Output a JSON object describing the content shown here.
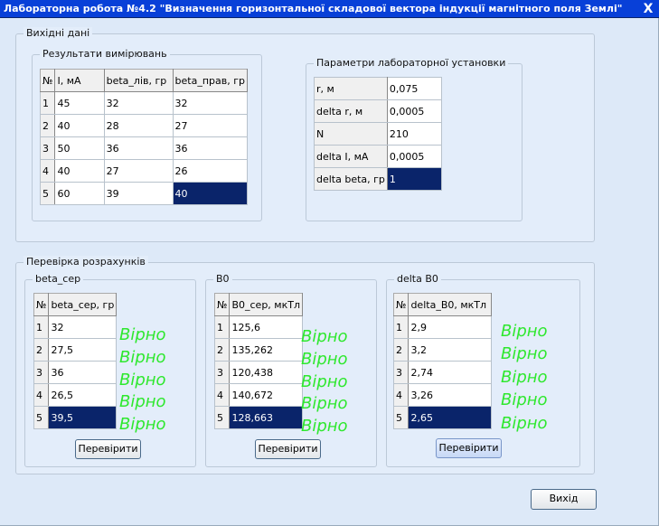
{
  "window": {
    "title": "Лабораторна робота №4.2 \"Визначення горизонтальної складової вектора індукції магнітного поля Землі\"",
    "close_glyph": "X"
  },
  "input_group": {
    "label": "Вихідні дані"
  },
  "measurements": {
    "label": "Результати вимірювань",
    "headers": [
      "№",
      "I, мА",
      "beta_лів, гр",
      "beta_прав, гр"
    ],
    "rows": [
      [
        "1",
        "45",
        "32",
        "32"
      ],
      [
        "2",
        "40",
        "28",
        "27"
      ],
      [
        "3",
        "50",
        "36",
        "36"
      ],
      [
        "4",
        "40",
        "27",
        "26"
      ],
      [
        "5",
        "60",
        "39",
        "40"
      ]
    ]
  },
  "parameters": {
    "label": "Параметри лабораторної установки",
    "rows": [
      [
        "r, м",
        "0,075"
      ],
      [
        "delta r, м",
        "0,0005"
      ],
      [
        "N",
        "210"
      ],
      [
        "delta I, мА",
        "0,0005"
      ],
      [
        "delta beta, гр",
        "1"
      ]
    ]
  },
  "check_group": {
    "label": "Перевірка розрахунків"
  },
  "beta_avg": {
    "label": "beta_сер",
    "headers": [
      "№",
      "beta_сер, гр"
    ],
    "rows": [
      [
        "1",
        "32"
      ],
      [
        "2",
        "27,5"
      ],
      [
        "3",
        "36"
      ],
      [
        "4",
        "26,5"
      ],
      [
        "5",
        "39,5"
      ]
    ],
    "button": "Перевірити"
  },
  "b0": {
    "label": "B0",
    "headers": [
      "№",
      "B0_сер, мкТл"
    ],
    "rows": [
      [
        "1",
        "125,6"
      ],
      [
        "2",
        "135,262"
      ],
      [
        "3",
        "120,438"
      ],
      [
        "4",
        "140,672"
      ],
      [
        "5",
        "128,663"
      ]
    ],
    "button": "Перевірити"
  },
  "delta_b0": {
    "label": "delta B0",
    "headers": [
      "№",
      "delta_B0, мкТл"
    ],
    "rows": [
      [
        "1",
        "2,9"
      ],
      [
        "2",
        "3,2"
      ],
      [
        "3",
        "2,74"
      ],
      [
        "4",
        "3,26"
      ],
      [
        "5",
        "2,65"
      ]
    ],
    "button": "Перевірити"
  },
  "verdict": "Вірно",
  "exit_button": "Вихід",
  "colors": {
    "titlebar": "#0840d8",
    "selection": "#0a246a",
    "verdict": "#2ee82e",
    "background": "#dde9f8"
  }
}
